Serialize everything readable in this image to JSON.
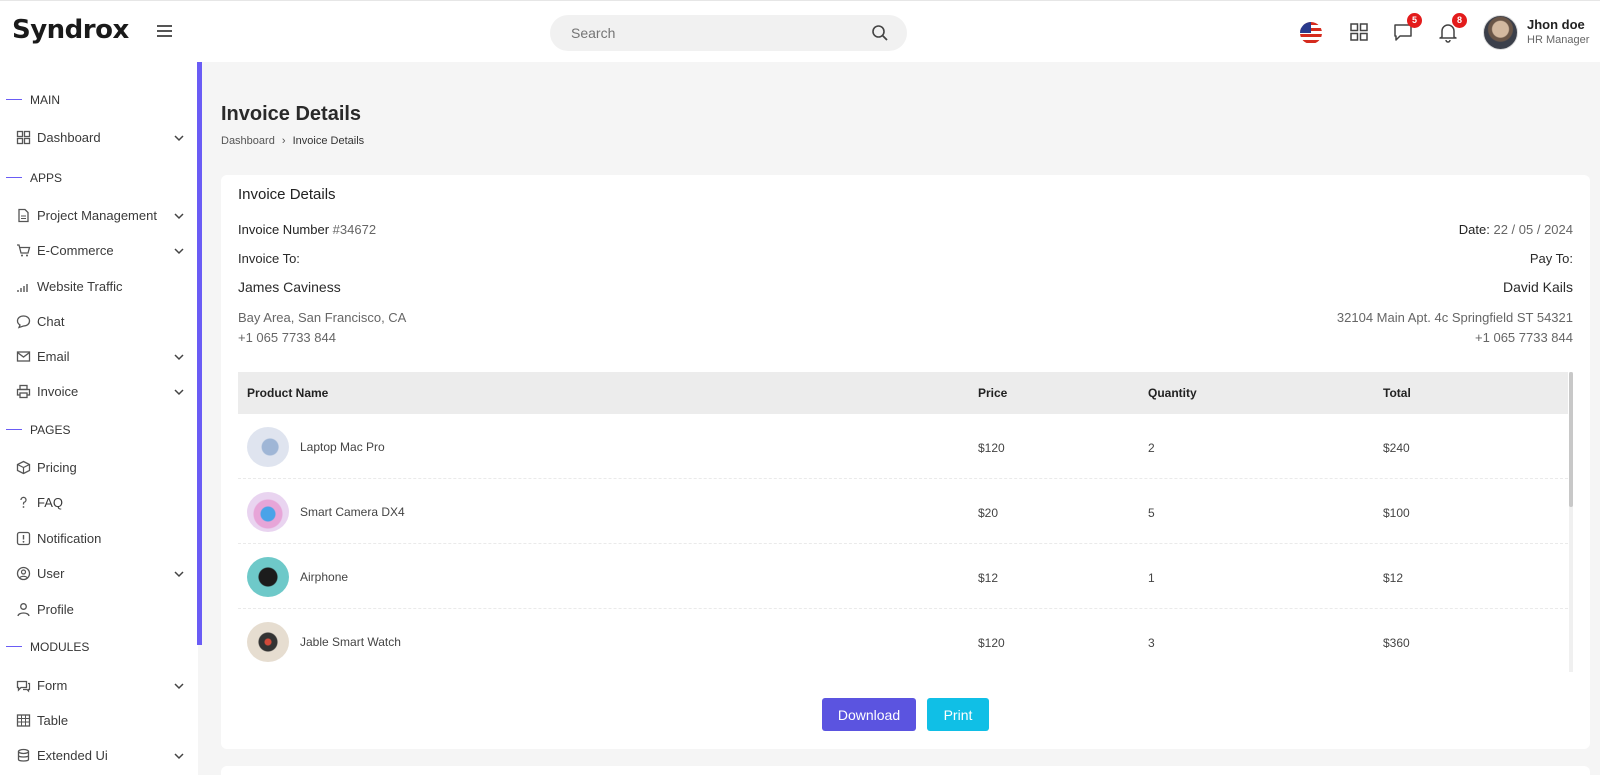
{
  "app": {
    "logo": "Syndrox"
  },
  "header": {
    "search_placeholder": "Search",
    "messages_count": "5",
    "notifications_count": "8",
    "user": {
      "name": "Jhon doe",
      "role": "HR Manager"
    }
  },
  "sidebar": {
    "sections": {
      "main": "MAIN",
      "apps": "APPS",
      "pages": "PAGES",
      "modules": "MODULES"
    },
    "items": {
      "dashboard": "Dashboard",
      "project_management": "Project Management",
      "ecommerce": "E-Commerce",
      "website_traffic": "Website Traffic",
      "chat": "Chat",
      "email": "Email",
      "invoice": "Invoice",
      "pricing": "Pricing",
      "faq": "FAQ",
      "notification": "Notification",
      "user": "User",
      "profile": "Profile",
      "form": "Form",
      "table": "Table",
      "extended_ui": "Extended Ui"
    },
    "accent_color": "#6a5cf5"
  },
  "page": {
    "title": "Invoice Details",
    "breadcrumb": {
      "home": "Dashboard",
      "current": "Invoice Details"
    }
  },
  "invoice": {
    "card_title": "Invoice Details",
    "number_label": "Invoice Number",
    "number": "#34672",
    "date_label": "Date:",
    "date": "22 / 05 / 2024",
    "invoice_to_label": "Invoice To:",
    "pay_to_label": "Pay To:",
    "to": {
      "name": "James Caviness",
      "address": "Bay Area, San Francisco, CA",
      "phone": "+1 065 7733 844"
    },
    "pay": {
      "name": "David Kails",
      "address": "32104 Main Apt. 4c Springfield ST 54321",
      "phone": "+1 065 7733 844"
    },
    "columns": [
      "Product Name",
      "Price",
      "Quantity",
      "Total"
    ],
    "rows": [
      {
        "name": "Laptop Mac Pro",
        "price": "$120",
        "qty": "2",
        "total": "$240"
      },
      {
        "name": "Smart Camera DX4",
        "price": "$20",
        "qty": "5",
        "total": "$100"
      },
      {
        "name": "Airphone",
        "price": "$12",
        "qty": "1",
        "total": "$12"
      },
      {
        "name": "Jable Smart Watch",
        "price": "$120",
        "qty": "3",
        "total": "$360"
      }
    ],
    "download_label": "Download",
    "print_label": "Print",
    "download_color": "#5b54e0",
    "print_color": "#10bfe6"
  }
}
